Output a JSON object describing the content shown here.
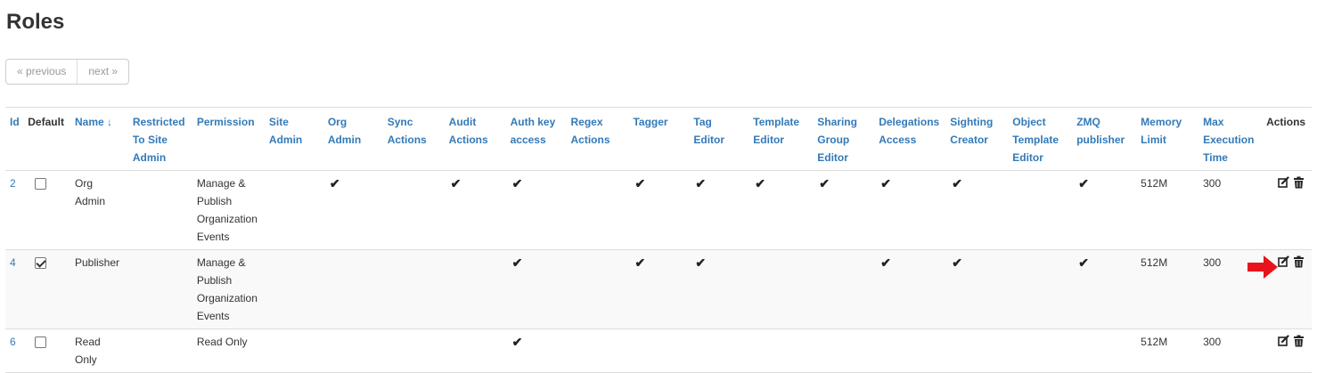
{
  "page": {
    "title": "Roles"
  },
  "pagination": {
    "previous": "« previous",
    "next": "next »"
  },
  "table": {
    "headers": {
      "id": "Id",
      "default": "Default",
      "name": "Name ↓",
      "restricted": "Restricted To Site Admin",
      "permission": "Permission",
      "site_admin": "Site Admin",
      "org_admin": "Org Admin",
      "sync_actions": "Sync Actions",
      "audit_actions": "Audit Actions",
      "auth_key_access": "Auth key access",
      "regex_actions": "Regex Actions",
      "tagger": "Tagger",
      "tag_editor": "Tag Editor",
      "template_editor": "Template Editor",
      "sharing_group_editor": "Sharing Group Editor",
      "delegations_access": "Delegations Access",
      "sighting_creator": "Sighting Creator",
      "object_template_editor": "Object Template Editor",
      "zmq_publisher": "ZMQ publisher",
      "memory_limit": "Memory Limit",
      "max_execution_time": "Max Execution Time",
      "actions": "Actions"
    },
    "rows": [
      {
        "id": "2",
        "default": false,
        "name": "Org Admin",
        "restricted": "",
        "permission": "Manage & Publish Organization Events",
        "flags": [
          false,
          true,
          false,
          true,
          true,
          false,
          true,
          true,
          true,
          true,
          true,
          true,
          false,
          true
        ],
        "memory_limit": "512M",
        "max_execution_time": "300",
        "highlight_edit": false
      },
      {
        "id": "4",
        "default": true,
        "name": "Publisher",
        "restricted": "",
        "permission": "Manage & Publish Organization Events",
        "flags": [
          false,
          false,
          false,
          false,
          true,
          false,
          true,
          true,
          false,
          false,
          true,
          true,
          false,
          true
        ],
        "memory_limit": "512M",
        "max_execution_time": "300",
        "highlight_edit": true
      },
      {
        "id": "6",
        "default": false,
        "name": "Read Only",
        "restricted": "",
        "permission": "Read Only",
        "flags": [
          false,
          false,
          false,
          false,
          true,
          false,
          false,
          false,
          false,
          false,
          false,
          false,
          false,
          false
        ],
        "memory_limit": "512M",
        "max_execution_time": "300",
        "highlight_edit": false
      }
    ]
  },
  "icons": {
    "tick": "check-icon",
    "edit": "edit-icon",
    "delete": "trash-icon",
    "pointer": "red-arrow-icon"
  },
  "colors": {
    "link": "#337ab7",
    "arrow": "#e8141b",
    "border": "#dddddd"
  }
}
